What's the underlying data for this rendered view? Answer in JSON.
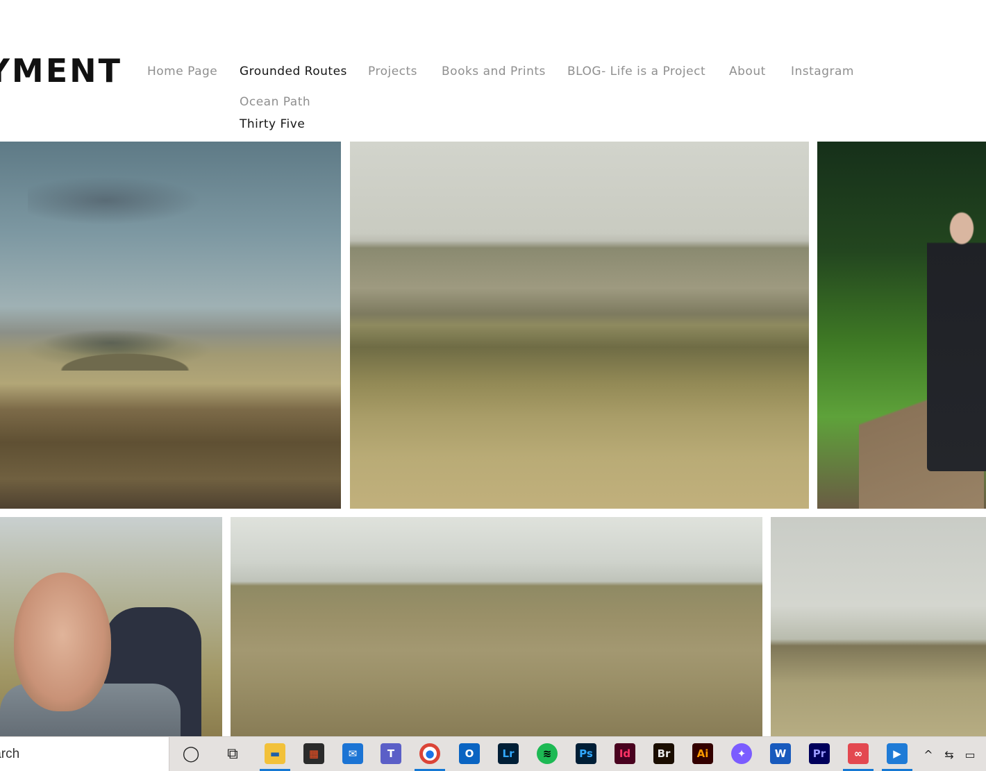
{
  "header": {
    "logo_text": "AYMENT",
    "nav": [
      {
        "label": "Home Page",
        "active": false
      },
      {
        "label": "Grounded Routes",
        "active": true
      },
      {
        "label": "Projects",
        "active": false
      },
      {
        "label": "Books and Prints",
        "active": false
      },
      {
        "label": "BLOG- Life is a Project",
        "active": false
      },
      {
        "label": "About",
        "active": false
      },
      {
        "label": "Instagram",
        "active": false
      }
    ],
    "submenu": [
      {
        "label": "Ocean Path",
        "active": false
      },
      {
        "label": "Thirty Five",
        "active": true
      }
    ]
  },
  "taskbar": {
    "search_text": "Search",
    "apps": [
      {
        "name": "cortana-icon",
        "glyph": "◯"
      },
      {
        "name": "task-view-icon",
        "glyph": "⧉"
      },
      {
        "name": "file-explorer-icon",
        "glyph": "▬"
      },
      {
        "name": "store-icon",
        "glyph": "▦"
      },
      {
        "name": "mail-icon",
        "glyph": "✉"
      },
      {
        "name": "teams-icon",
        "glyph": "T"
      },
      {
        "name": "chrome-icon",
        "glyph": "●"
      },
      {
        "name": "outlook-icon",
        "glyph": "O"
      },
      {
        "name": "lightroom-icon",
        "glyph": "Lr"
      },
      {
        "name": "spotify-icon",
        "glyph": "≋"
      },
      {
        "name": "photoshop-icon",
        "glyph": "Ps"
      },
      {
        "name": "indesign-icon",
        "glyph": "Id"
      },
      {
        "name": "bridge-icon",
        "glyph": "Br"
      },
      {
        "name": "illustrator-icon",
        "glyph": "Ai"
      },
      {
        "name": "messenger-icon",
        "glyph": "✦"
      },
      {
        "name": "word-icon",
        "glyph": "W"
      },
      {
        "name": "premiere-icon",
        "glyph": "Pr"
      },
      {
        "name": "creative-cloud-icon",
        "glyph": "∞"
      },
      {
        "name": "media-player-icon",
        "glyph": "▶"
      }
    ],
    "tray": [
      {
        "name": "chevron-up-icon",
        "glyph": "^"
      },
      {
        "name": "network-icon",
        "glyph": "⇆"
      },
      {
        "name": "battery-icon",
        "glyph": "▭"
      }
    ]
  }
}
